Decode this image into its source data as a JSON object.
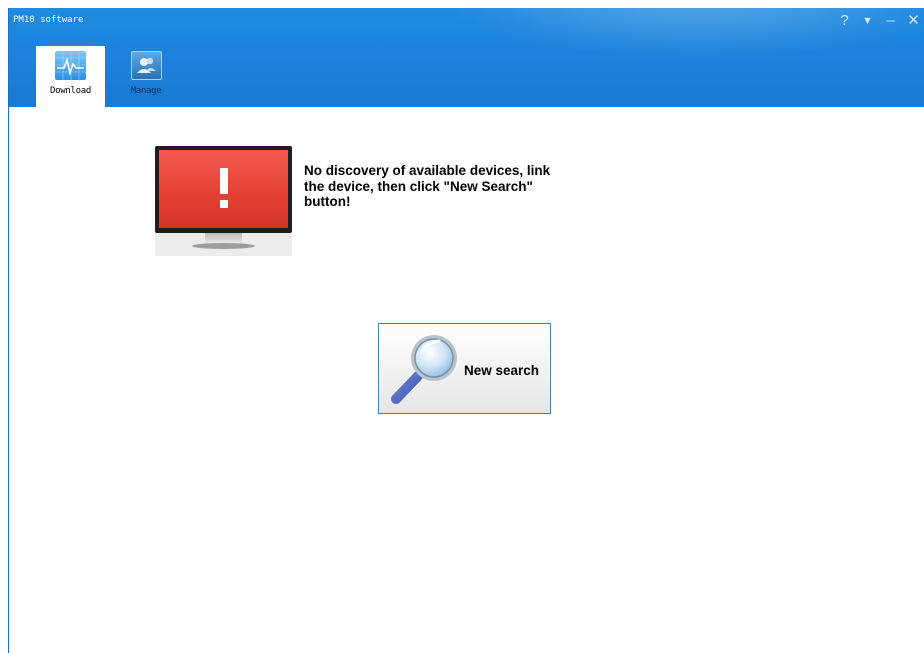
{
  "window": {
    "title": "PM10 software",
    "controls": [
      {
        "symbol": "?",
        "icon": "help-icon"
      },
      {
        "symbol": "▼",
        "icon": "menu-dropdown-icon"
      },
      {
        "symbol": "–",
        "icon": "minimize-icon"
      },
      {
        "symbol": "✕",
        "icon": "close-icon"
      }
    ]
  },
  "tabs": [
    {
      "label": "Download",
      "icon": "download-chart-icon",
      "active": true
    },
    {
      "label": "Manage",
      "icon": "users-icon",
      "active": false
    }
  ],
  "main": {
    "status_icon": "monitor-warning-icon",
    "message": "No discovery of available devices, link the device, then click \"New Search\" button!",
    "search_button_label": "New search",
    "search_button_icon": "magnifier-icon"
  },
  "colors": {
    "titlebar": "#1c83dc",
    "warning_screen": "#e33f33",
    "button_border": "#4a7fb0"
  }
}
